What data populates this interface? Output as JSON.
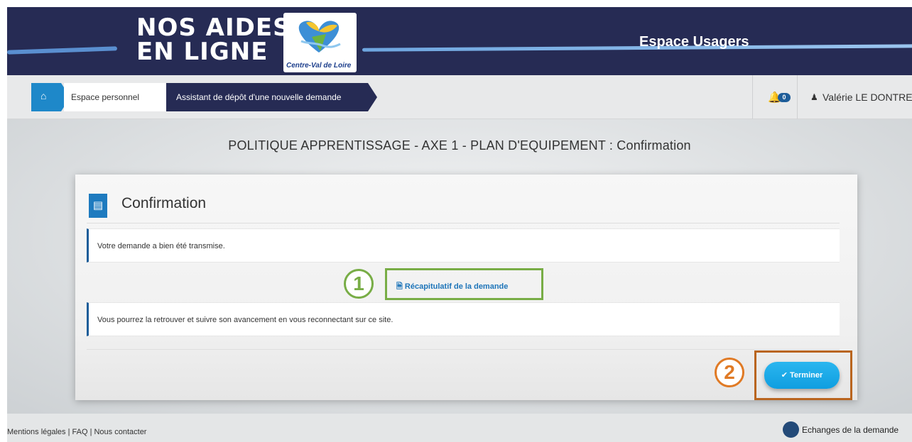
{
  "header": {
    "logo_line1": "NOS AIDES",
    "logo_line2": "EN LIGNE",
    "logo_caption": "Centre-Val de Loire",
    "section_title": "Espace Usagers"
  },
  "breadcrumb": {
    "home_icon": "home-icon",
    "items": [
      "Espace personnel",
      "Assistant de dépôt d'une nouvelle demande"
    ]
  },
  "user_menu": {
    "notification_count": "0",
    "user_name": "Valérie LE DONTREC"
  },
  "page": {
    "title": "POLITIQUE APPRENTISSAGE - AXE 1 - PLAN D'EQUIPEMENT : Confirmation"
  },
  "panel": {
    "title": "Confirmation",
    "message_sent": "Votre demande a bien été transmise.",
    "recap_link": "Récapitulatif de la demande",
    "message_follow": "Vous pourrez la retrouver et suivre son avancement en vous reconnectant sur ce site.",
    "finish_button": "Terminer"
  },
  "annotations": {
    "step1": "1",
    "step2": "2",
    "step1_color": "#78ad46",
    "step2_color": "#e07a25"
  },
  "footer": {
    "links": "Mentions légales | FAQ | Nous contacter",
    "echanges": "Echanges de la demande"
  },
  "colors": {
    "header_bg": "#262b54",
    "accent": "#1e88c9",
    "button": "#1a9fe0"
  }
}
